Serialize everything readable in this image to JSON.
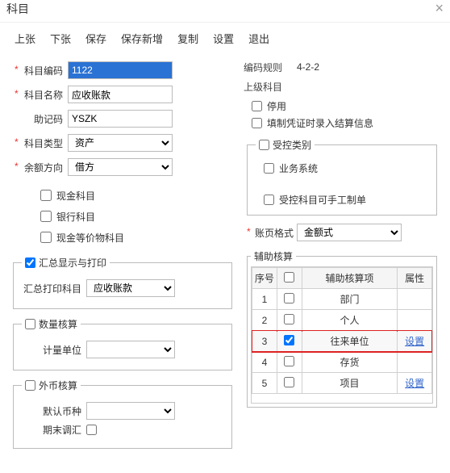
{
  "header": {
    "title": "科目"
  },
  "toolbar": [
    "上张",
    "下张",
    "保存",
    "保存新增",
    "复制",
    "设置",
    "退出"
  ],
  "form": {
    "code_label": "科目编码",
    "code_value": "1122",
    "name_label": "科目名称",
    "name_value": "应收账款",
    "mnemonic_label": "助记码",
    "mnemonic_value": "YSZK",
    "type_label": "科目类型",
    "type_value": "资产",
    "balance_label": "余额方向",
    "balance_value": "借方"
  },
  "checks": {
    "cash": "现金科目",
    "bank": "银行科目",
    "cashequiv": "现金等价物科目"
  },
  "right_info": {
    "rule_label": "编码规则",
    "rule_value": "4-2-2",
    "parent_label": "上级科目",
    "disable": "停用",
    "voucher": "填制凭证时录入结算信息"
  },
  "controlled": {
    "legend": "受控类别",
    "biz": "业务系统",
    "manual": "受控科目可手工制单"
  },
  "acct_format": {
    "label": "账页格式",
    "value": "金额式"
  },
  "summary": {
    "legend": "汇总显示与打印",
    "field": "汇总打印科目",
    "value": "应收账款"
  },
  "qty": {
    "legend": "数量核算",
    "field": "计量单位"
  },
  "fx": {
    "legend": "外币核算",
    "field": "默认币种",
    "reval": "期末调汇"
  },
  "aux": {
    "legend": "辅助核算",
    "cols": {
      "idx": "序号",
      "item": "辅助核算项",
      "attr": "属性"
    },
    "rows": [
      {
        "idx": "1",
        "item": "部门",
        "checked": false,
        "link": ""
      },
      {
        "idx": "2",
        "item": "个人",
        "checked": false,
        "link": ""
      },
      {
        "idx": "3",
        "item": "往来单位",
        "checked": true,
        "link": "设置",
        "hl": true
      },
      {
        "idx": "4",
        "item": "存货",
        "checked": false,
        "link": ""
      },
      {
        "idx": "5",
        "item": "项目",
        "checked": false,
        "link": "设置"
      }
    ]
  }
}
